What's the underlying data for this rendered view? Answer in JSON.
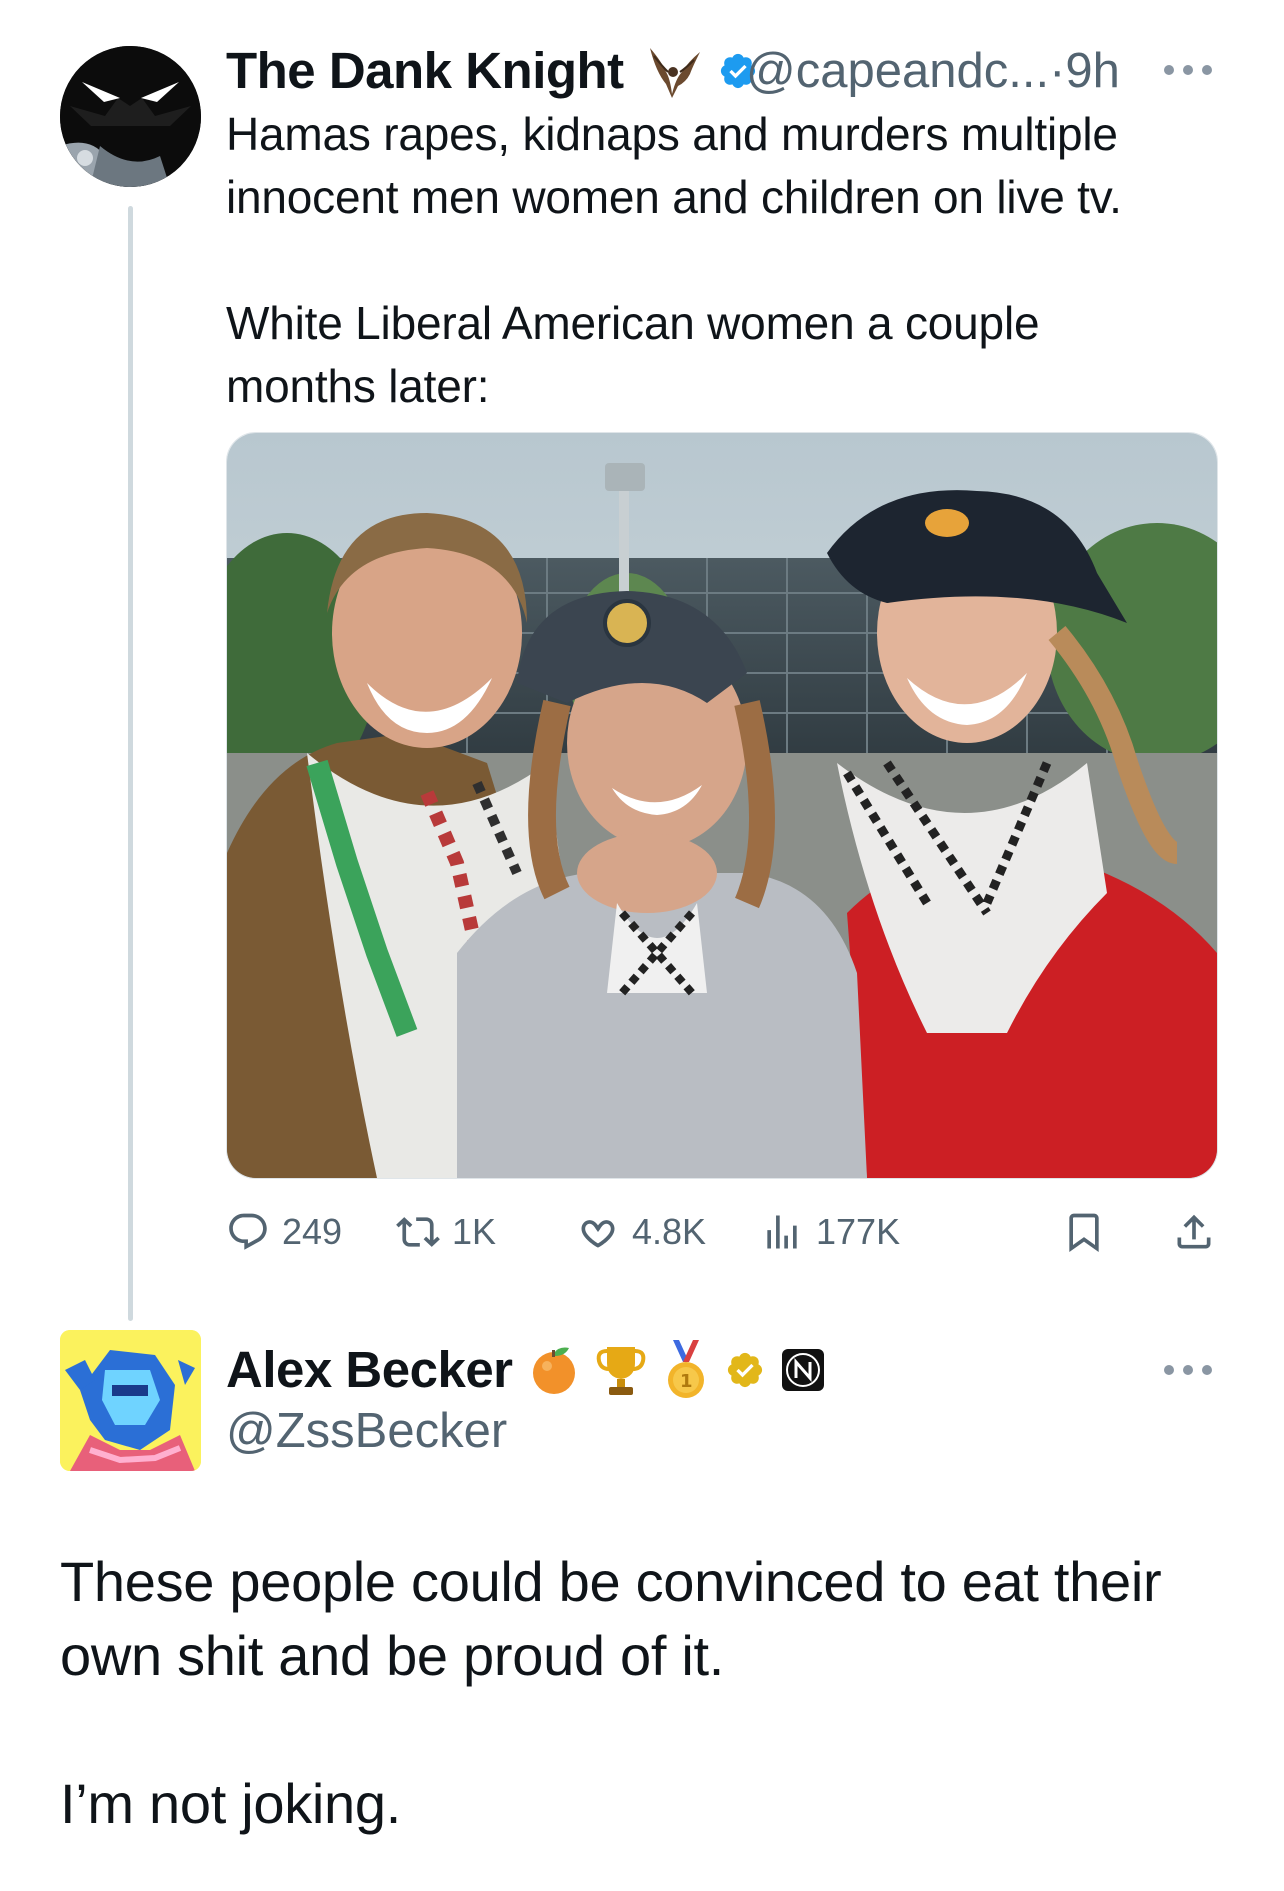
{
  "parent_tweet": {
    "display_name": "The Dank Knight",
    "name_emoji": "bat-emoji",
    "handle": "@capeandc...",
    "separator": "·",
    "time": "9h",
    "text": "Hamas rapes, kidnaps and murders multiple\ninnocent men women and children on live tv.\n\nWhite Liberal American women a couple\nmonths later:",
    "media_image": "photo of three smiling women wearing keffiyeh scarves and caps outdoors in front of a building",
    "stats": {
      "replies": "249",
      "reposts": "1K",
      "likes": "4.8K",
      "views": "177K"
    }
  },
  "reply_tweet": {
    "display_name": "Alex Becker",
    "badges": [
      "orange-emoji",
      "trophy-emoji",
      "first-place-medal-emoji",
      "gold-verified-badge",
      "affiliate-badge"
    ],
    "handle": "@ZssBecker",
    "text": "These people could be convinced to eat their\nown shit and be proud of it.\n\nI’m not joking."
  },
  "colors": {
    "text_primary": "#0f1419",
    "text_secondary": "#536471",
    "verified_blue": "#1d9bf0",
    "verified_gold": "#e2b719",
    "thread_line": "#cfd9de"
  }
}
